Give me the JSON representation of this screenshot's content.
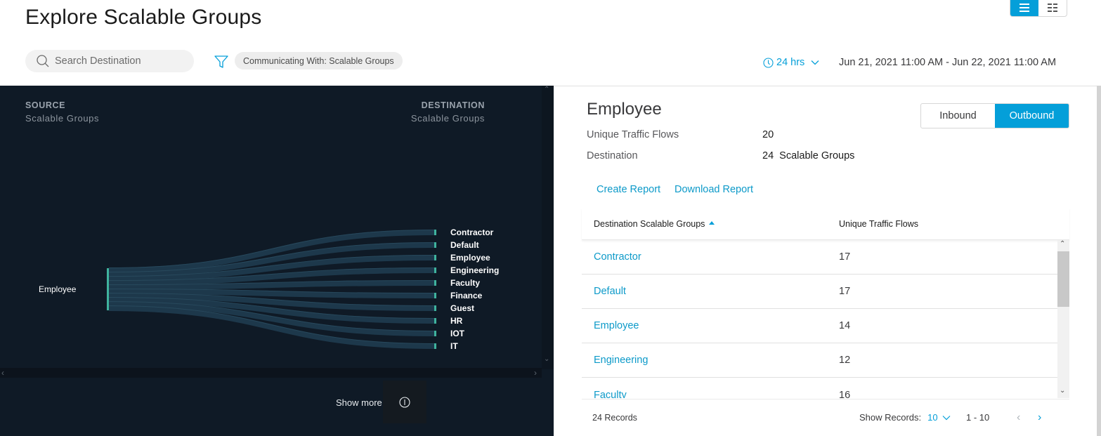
{
  "header": {
    "title": "Explore Scalable Groups",
    "view_toggle": [
      {
        "icon": "list-view-icon",
        "active": true
      },
      {
        "icon": "grid-view-icon",
        "active": false
      }
    ],
    "search": {
      "placeholder": "Search Destination",
      "value": ""
    },
    "filter_chip": "Communicating With: Scalable Groups",
    "time_picker": {
      "label": "24 hrs"
    },
    "time_range": "Jun 21, 2021 11:00 AM - Jun 22, 2021 11:00 AM"
  },
  "flow": {
    "source_header": "SOURCE",
    "source_sub": "Scalable Groups",
    "destination_header": "DESTINATION",
    "destination_sub": "Scalable Groups",
    "source_node": "Employee",
    "destination_nodes": [
      "Contractor",
      "Default",
      "Employee",
      "Engineering",
      "Faculty",
      "Finance",
      "Guest",
      "HR",
      "IOT",
      "IT"
    ],
    "show_more": "Show more",
    "colors": {
      "node": "#3fb39e",
      "link": "#1f3a4d",
      "link_edge": "#2f5468",
      "background": "#0f1a26"
    }
  },
  "detail": {
    "title": "Employee",
    "unique_flows_label": "Unique Traffic Flows",
    "unique_flows_value": "20",
    "destination_label": "Destination",
    "destination_value": "24  Scalable Groups",
    "direction": {
      "inbound": "Inbound",
      "outbound": "Outbound",
      "active": "Outbound"
    },
    "create_report": "Create Report",
    "download_report": "Download Report",
    "table": {
      "columns": [
        "Destination Scalable Groups",
        "Unique Traffic Flows"
      ],
      "rows": [
        {
          "group": "Contractor",
          "flows": "17"
        },
        {
          "group": "Default",
          "flows": "17"
        },
        {
          "group": "Employee",
          "flows": "14"
        },
        {
          "group": "Engineering",
          "flows": "12"
        },
        {
          "group": "Faculty",
          "flows": "16"
        }
      ]
    },
    "footer": {
      "records": "24 Records",
      "show_records_label": "Show Records:",
      "show_records_value": "10",
      "range": "1 - 10"
    }
  },
  "colors": {
    "accent": "#049fd9",
    "link": "#0d9ac9"
  }
}
